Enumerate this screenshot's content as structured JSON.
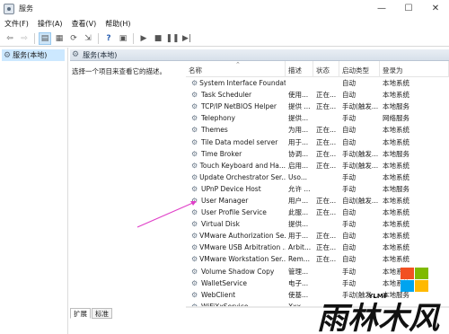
{
  "window": {
    "title": "服务",
    "controls": [
      "—",
      "☐",
      "✕"
    ]
  },
  "menu": [
    "文件(F)",
    "操作(A)",
    "查看(V)",
    "帮助(H)"
  ],
  "tree": {
    "item": "服务(本地)"
  },
  "pane": {
    "header": "服务(本地)",
    "description": "选择一个项目来查看它的描述。"
  },
  "columns": {
    "name": "名称",
    "desc": "描述",
    "status": "状态",
    "start": "启动类型",
    "logon": "登录为"
  },
  "services": [
    {
      "name": "System Interface Foundat...",
      "desc": "",
      "status": "",
      "start": "自动",
      "logon": "本地系统"
    },
    {
      "name": "Task Scheduler",
      "desc": "使用...",
      "status": "正在...",
      "start": "自动",
      "logon": "本地系统"
    },
    {
      "name": "TCP/IP NetBIOS Helper",
      "desc": "提供 ...",
      "status": "正在...",
      "start": "手动(触发...",
      "logon": "本地服务"
    },
    {
      "name": "Telephony",
      "desc": "提供...",
      "status": "",
      "start": "手动",
      "logon": "网络服务"
    },
    {
      "name": "Themes",
      "desc": "为用...",
      "status": "正在...",
      "start": "自动",
      "logon": "本地系统"
    },
    {
      "name": "Tile Data model server",
      "desc": "用于...",
      "status": "正在...",
      "start": "自动",
      "logon": "本地系统"
    },
    {
      "name": "Time Broker",
      "desc": "协调...",
      "status": "正在...",
      "start": "手动(触发...",
      "logon": "本地服务"
    },
    {
      "name": "Touch Keyboard and Ha...",
      "desc": "启用...",
      "status": "正在...",
      "start": "手动(触发...",
      "logon": "本地系统"
    },
    {
      "name": "Update Orchestrator Ser...",
      "desc": "Uso...",
      "status": "",
      "start": "手动",
      "logon": "本地系统"
    },
    {
      "name": "UPnP Device Host",
      "desc": "允许 ...",
      "status": "",
      "start": "手动",
      "logon": "本地服务"
    },
    {
      "name": "User Manager",
      "desc": "用户...",
      "status": "正在...",
      "start": "自动(触发...",
      "logon": "本地系统"
    },
    {
      "name": "User Profile Service",
      "desc": "此服...",
      "status": "正在...",
      "start": "自动",
      "logon": "本地系统"
    },
    {
      "name": "Virtual Disk",
      "desc": "提供...",
      "status": "",
      "start": "手动",
      "logon": "本地系统"
    },
    {
      "name": "VMware Authorization Se...",
      "desc": "用于...",
      "status": "正在...",
      "start": "自动",
      "logon": "本地系统"
    },
    {
      "name": "VMware USB Arbitration ...",
      "desc": "Arbit...",
      "status": "正在...",
      "start": "自动",
      "logon": "本地系统"
    },
    {
      "name": "VMware Workstation Ser...",
      "desc": "Rem...",
      "status": "正在...",
      "start": "自动",
      "logon": "本地系统"
    },
    {
      "name": "Volume Shadow Copy",
      "desc": "管理...",
      "status": "",
      "start": "手动",
      "logon": "本地系统"
    },
    {
      "name": "WalletService",
      "desc": "电子...",
      "status": "",
      "start": "手动",
      "logon": "本地系统"
    },
    {
      "name": "WebClient",
      "desc": "使基...",
      "status": "",
      "start": "手动(触发...",
      "logon": "本地服务"
    },
    {
      "name": "WiFiXxService",
      "desc": "Xxx...",
      "status": "",
      "start": "",
      "logon": ""
    }
  ],
  "tabs": [
    "扩展",
    "标准"
  ],
  "watermark": {
    "brand": "雨林木风",
    "sub": "YLMF",
    "logo_colors": [
      "#f25022",
      "#7fba00",
      "#00a4ef",
      "#ffb900"
    ]
  },
  "icons": {
    "gear": "gear-icon",
    "arrow_color": "#e040c8"
  }
}
